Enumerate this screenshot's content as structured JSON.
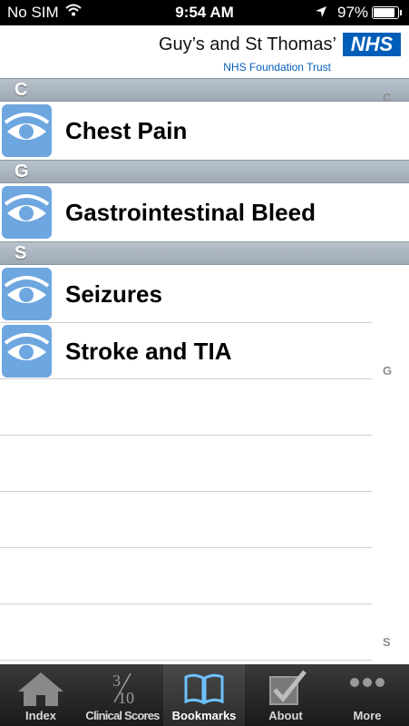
{
  "status": {
    "carrier": "No SIM",
    "time": "9:54 AM",
    "battery": "97%",
    "battery_level": 0.97
  },
  "header": {
    "org": "Guy’s and St Thomas’",
    "trust": "NHS Foundation Trust",
    "logo": "NHS"
  },
  "sections": [
    {
      "letter": "C",
      "items": [
        "Chest Pain"
      ]
    },
    {
      "letter": "G",
      "items": [
        "Gastrointestinal Bleed"
      ]
    },
    {
      "letter": "S",
      "items": [
        "Seizures",
        "Stroke and TIA"
      ]
    }
  ],
  "index": [
    "C",
    "G",
    "S"
  ],
  "tabs": [
    {
      "label": "Index",
      "icon": "home-icon"
    },
    {
      "label": "Clinical Scores",
      "icon": "score-icon",
      "icon_text_top": "3",
      "icon_text_bottom": "10"
    },
    {
      "label": "Bookmarks",
      "icon": "book-icon",
      "active": true
    },
    {
      "label": "About",
      "icon": "checkbox-icon"
    },
    {
      "label": "More",
      "icon": "more-icon"
    }
  ],
  "colors": {
    "nhs_blue": "#005eb8",
    "icon_blue": "#6ea6e0"
  }
}
